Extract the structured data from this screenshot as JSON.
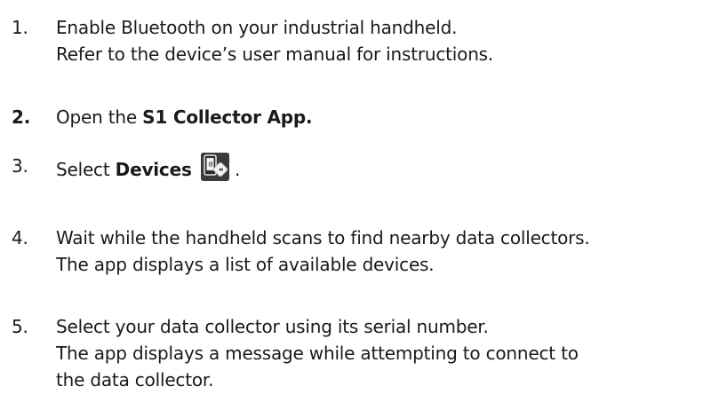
{
  "steps": [
    {
      "number": "1.",
      "lines": [
        "Enable Bluetooth on your industrial handheld.",
        "Refer to the device’s user manual for instructions."
      ]
    },
    {
      "number": "2.",
      "prefix": "Open the ",
      "bold": "S1 Collector App."
    },
    {
      "number": "3.",
      "prefix": "Select ",
      "bold": "Devices",
      "suffix": " .",
      "icon": "devices-icon"
    },
    {
      "number": "4.",
      "lines": [
        "Wait while the handheld scans to find nearby data collectors.",
        "The app displays a list of available devices."
      ]
    },
    {
      "number": "5.",
      "lines": [
        "Select your data collector using its serial number.",
        "The app displays a message while attempting to connect to",
        "the data collector."
      ]
    }
  ],
  "colors": {
    "text": "#1a1a1a",
    "icon_bg": "#3b3b3b"
  }
}
